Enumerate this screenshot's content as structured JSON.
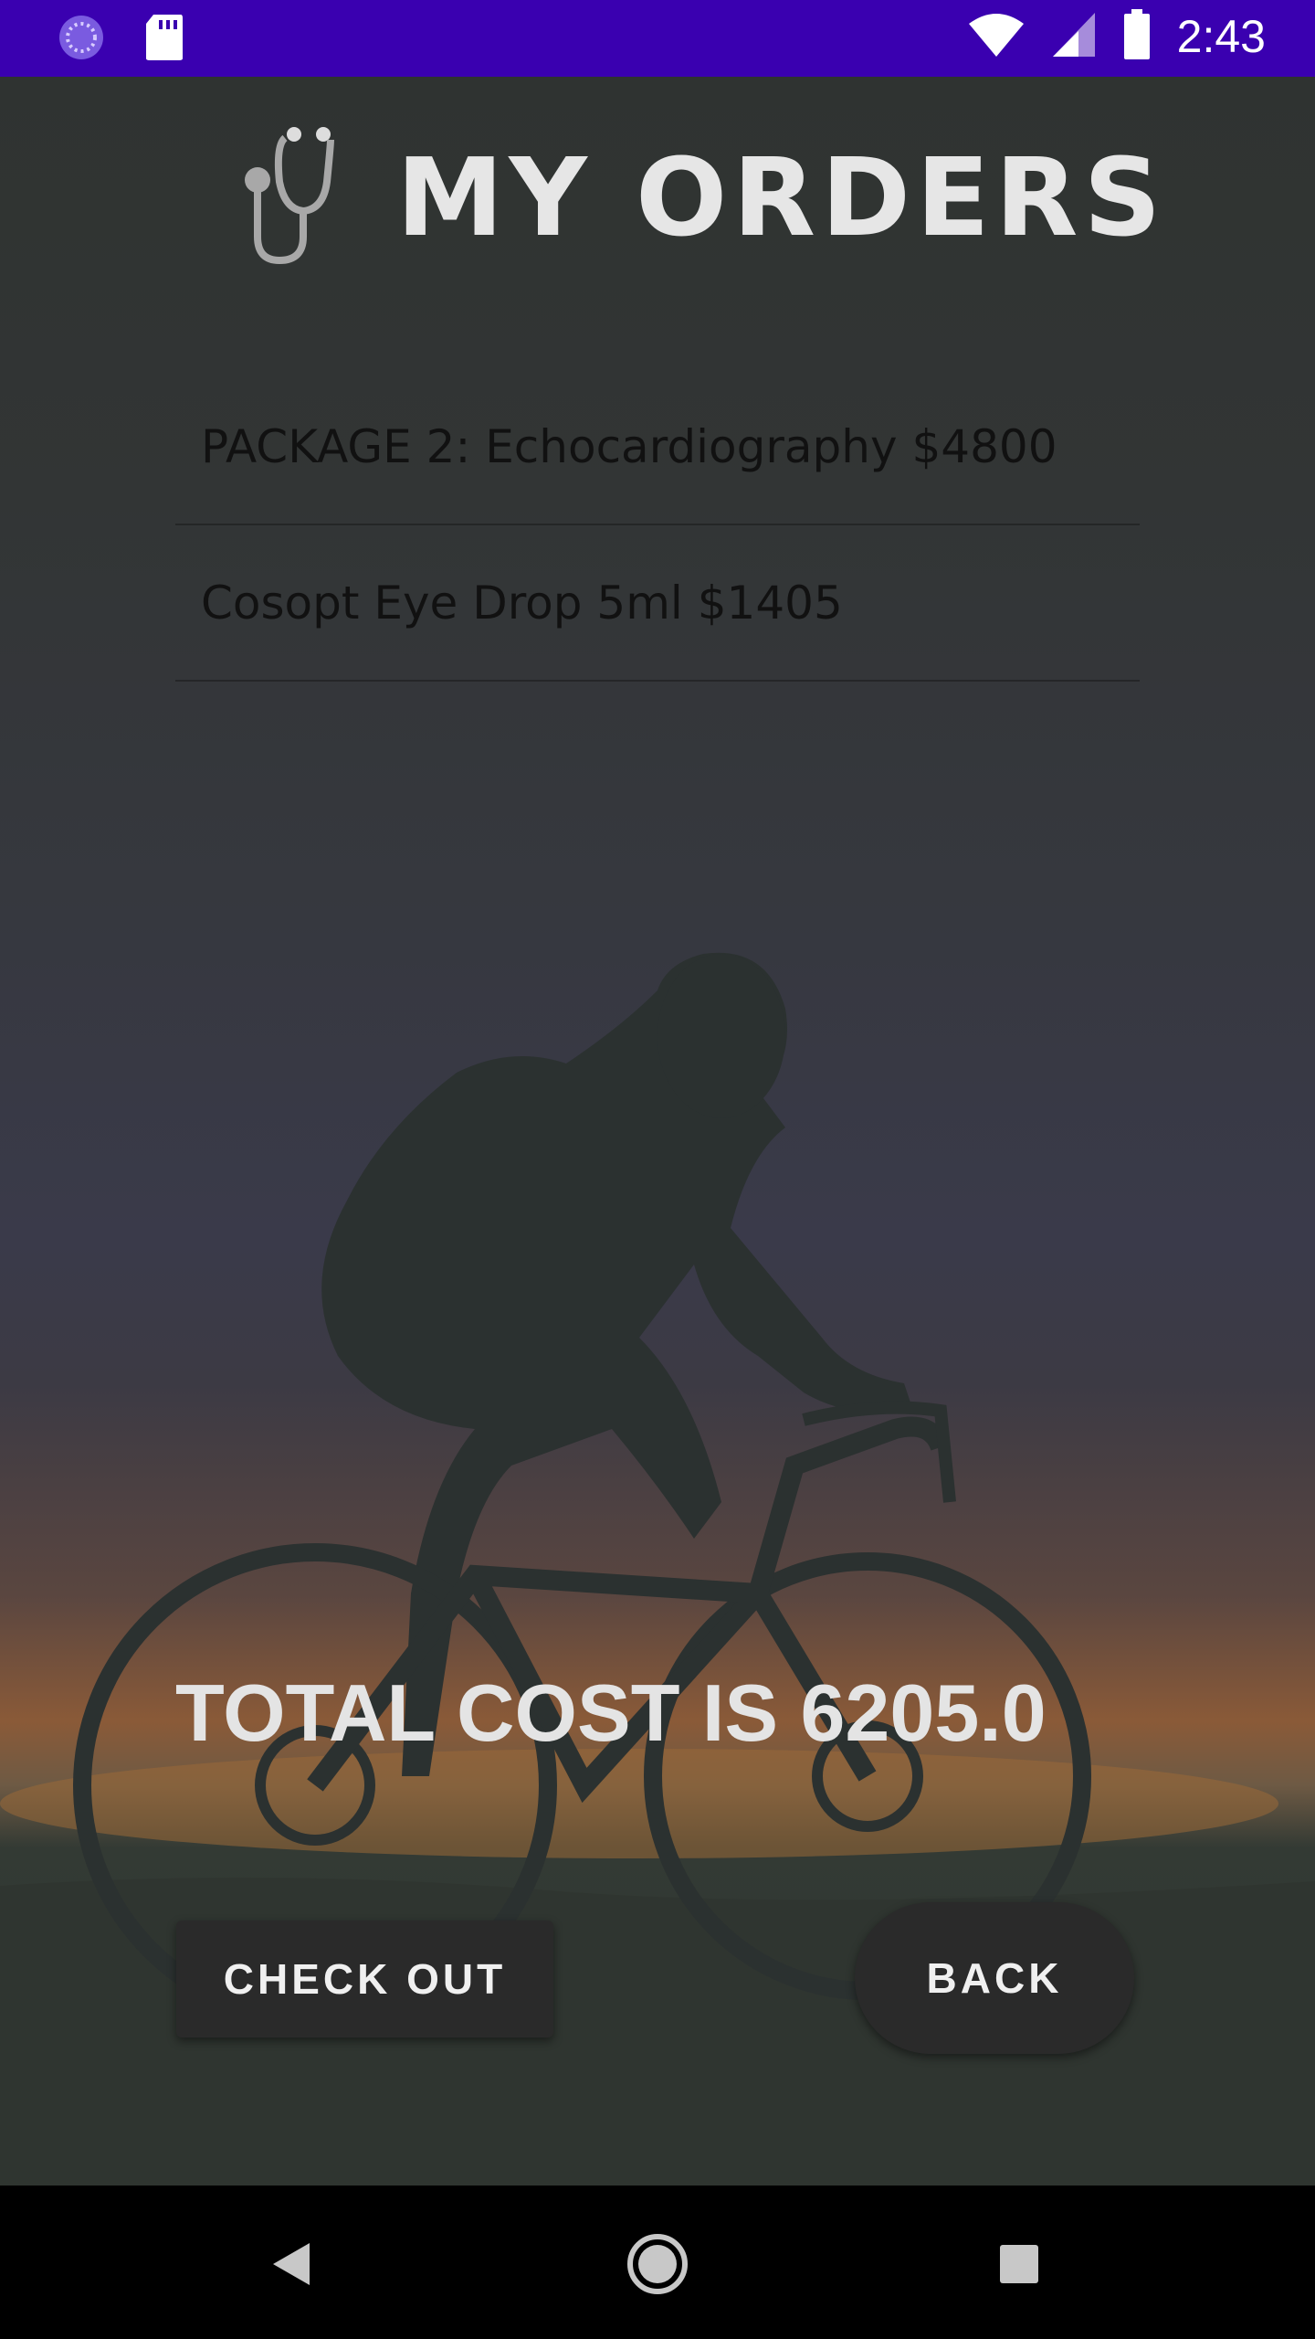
{
  "status_bar": {
    "time": "2:43",
    "icons": [
      "sync-circle-icon",
      "sd-card-icon",
      "wifi-icon",
      "cell-signal-icon",
      "battery-icon"
    ]
  },
  "header": {
    "title": "MY ORDERS",
    "icon": "stethoscope-icon"
  },
  "orders": [
    {
      "label": "PACKAGE 2: Echocardiography $4800"
    },
    {
      "label": "Cosopt Eye Drop 5ml $1405"
    }
  ],
  "total": {
    "text": "TOTAL COST IS 6205.0"
  },
  "buttons": {
    "checkout_label": "CHECK OUT",
    "back_label": "BACK"
  },
  "nav_bar": {
    "icons": [
      "back-triangle-icon",
      "home-circle-icon",
      "recents-square-icon"
    ]
  },
  "colors": {
    "status_bar": "#3a00b0",
    "button_bg": "#2a2a2a",
    "title_text": "#e6e6e6"
  }
}
